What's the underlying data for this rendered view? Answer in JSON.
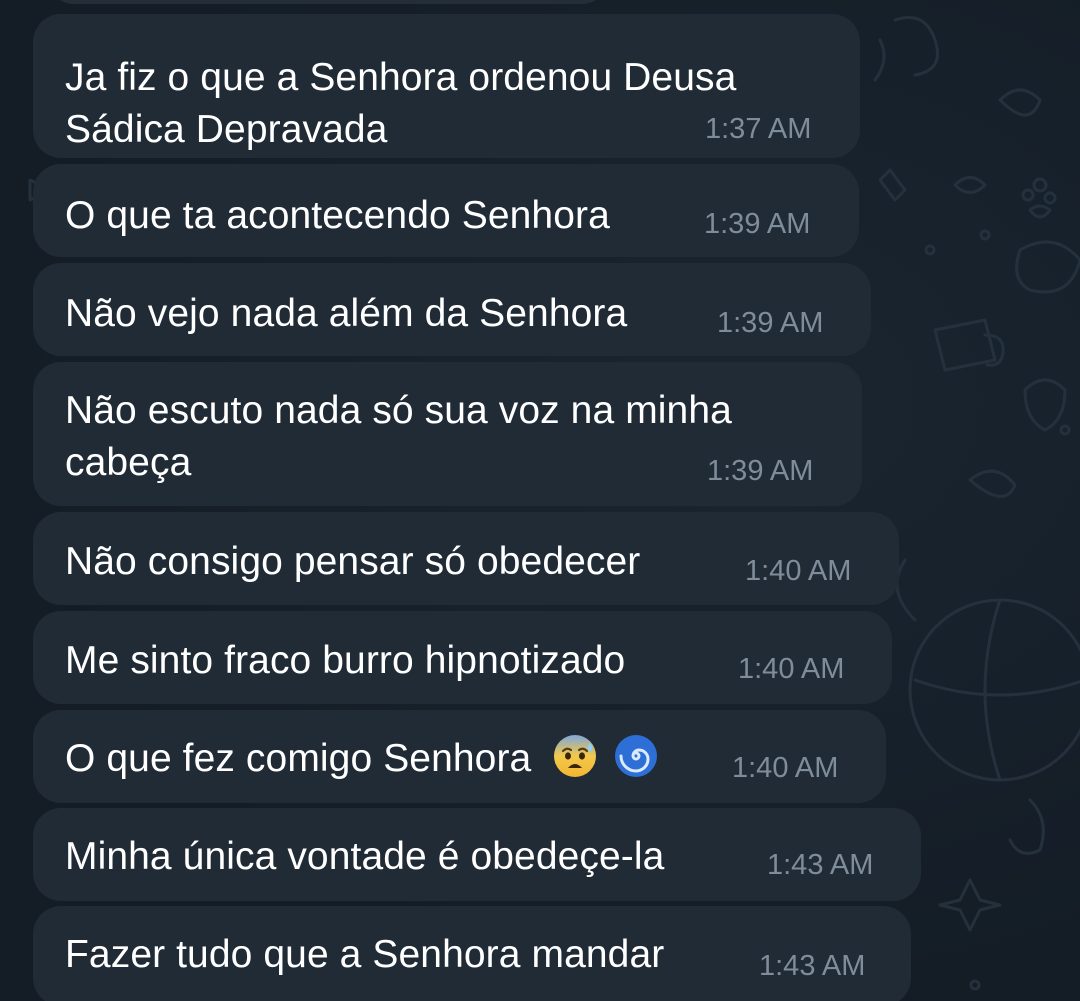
{
  "chat": {
    "messages": [
      {
        "lines": [
          "Ja fiz o que a Senhora ordenou Deusa",
          "Sádica Depravada"
        ],
        "time": "1:37 AM"
      },
      {
        "lines": [
          "O que ta acontecendo Senhora"
        ],
        "time": "1:39 AM"
      },
      {
        "lines": [
          "Não vejo nada além da Senhora"
        ],
        "time": "1:39 AM"
      },
      {
        "lines": [
          "Não escuto nada só sua voz na minha",
          "cabeça"
        ],
        "time": "1:39 AM"
      },
      {
        "lines": [
          "Não consigo pensar só obedecer"
        ],
        "time": "1:40 AM"
      },
      {
        "lines": [
          "Me sinto fraco burro hipnotizado"
        ],
        "time": "1:40 AM"
      },
      {
        "lines": [
          "O que fez comigo Senhora"
        ],
        "emojis": [
          "anxious-face-with-sweat-icon",
          "cyclone-icon"
        ],
        "time": "1:40 AM"
      },
      {
        "lines": [
          "Minha única vontade é obedeçe-la"
        ],
        "time": "1:43 AM"
      },
      {
        "lines": [
          "Fazer tudo que a Senhora mandar"
        ],
        "time": "1:43 AM"
      }
    ]
  },
  "colors": {
    "background": "#141d26",
    "bubble": "#202b36",
    "text": "#ffffff",
    "time": "#7f8c99"
  }
}
